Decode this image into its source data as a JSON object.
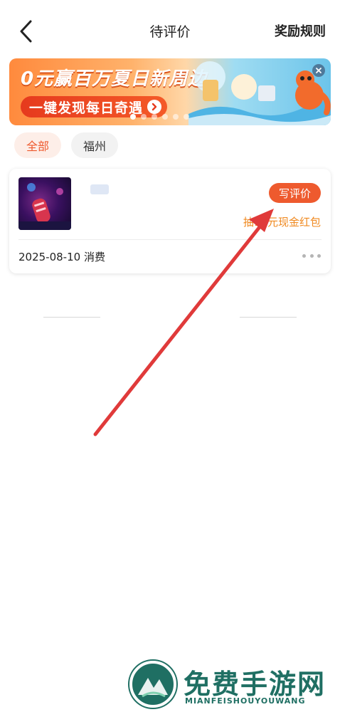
{
  "header": {
    "title": "待评价",
    "rules_label": "奖励规则",
    "back_icon": "chevron-left-icon"
  },
  "banner": {
    "title": "0元赢百万夏日新周边",
    "cta_label": "一键发现每日奇遇",
    "close_icon": "close-icon",
    "slide_count": 6,
    "active_slide": 0
  },
  "filters": [
    {
      "label": "全部",
      "active": true
    },
    {
      "label": "福州",
      "active": false
    }
  ],
  "order": {
    "review_button": "写评价",
    "reward_note": "抽10元现金红包",
    "date_label": "2025-08-10 消费",
    "more_icon": "more-dots-icon"
  },
  "watermark": {
    "title": "免费手游网",
    "subtitle": "MIANFEISHOUYOUWANG"
  },
  "colors": {
    "accent": "#ee5a2e",
    "reward": "#f0891f",
    "annotation": "#e03a3a",
    "watermark": "#1f6f63"
  }
}
